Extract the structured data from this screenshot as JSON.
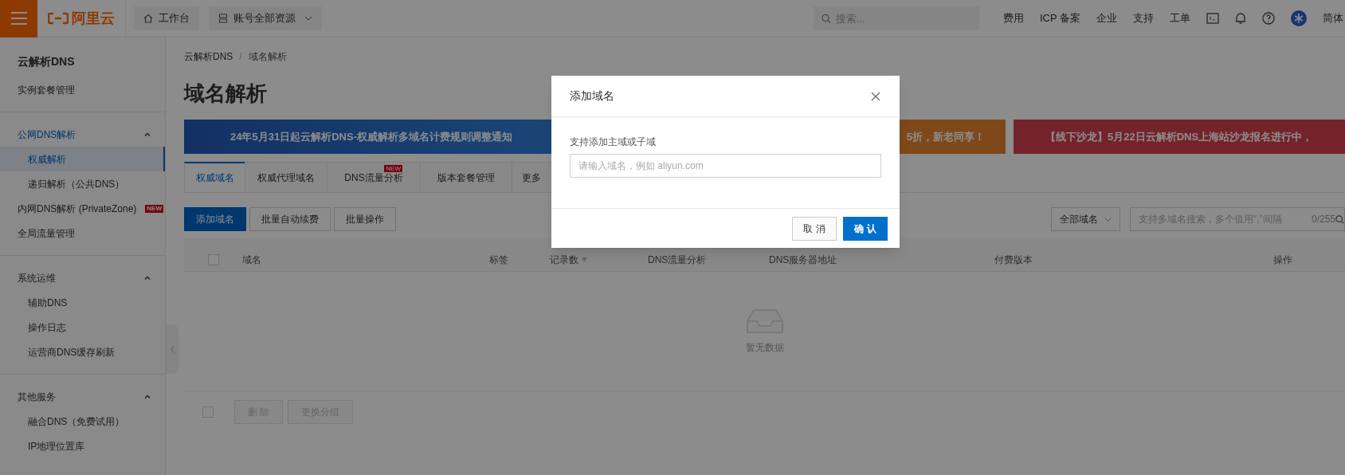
{
  "top_bar": {
    "brand": "阿里云",
    "workbench": "工作台",
    "resources": "账号全部资源",
    "search": {
      "placeholder": "搜索..."
    },
    "links": [
      "费用",
      "ICP 备案",
      "企业",
      "支持",
      "工单"
    ],
    "language": "简体"
  },
  "sidebar": {
    "title": "云解析DNS",
    "sections": [
      {
        "entries": [
          {
            "label": "实例套餐管理",
            "selected": false
          }
        ]
      },
      {
        "entries": [
          {
            "label": "公网DNS解析",
            "expanded": true,
            "selected": false,
            "children": [
              {
                "label": "权威解析",
                "selected": true
              },
              {
                "label": "递归解析（公共DNS）",
                "selected": false
              }
            ]
          },
          {
            "label": "内网DNS解析 (PrivateZone)",
            "badge": "NEW",
            "selected": false
          },
          {
            "label": "全局流量管理",
            "selected": false
          }
        ]
      },
      {
        "entries": [
          {
            "label": "系统运维",
            "expanded": true,
            "selected": false,
            "children": [
              {
                "label": "辅助DNS",
                "selected": false
              },
              {
                "label": "操作日志",
                "selected": false
              },
              {
                "label": "运营商DNS缓存刷新",
                "selected": false
              }
            ]
          }
        ]
      },
      {
        "entries": [
          {
            "label": "其他服务",
            "expanded": true,
            "selected": false,
            "children": [
              {
                "label": "融合DNS（免费试用）",
                "selected": false
              },
              {
                "label": "IP地理位置库",
                "selected": false
              }
            ]
          }
        ]
      }
    ]
  },
  "breadcrumb": [
    "云解析DNS",
    "域名解析"
  ],
  "breadcrumb_separator": "/",
  "page_title": "域名解析",
  "banners": [
    {
      "text": "24年5月31日起云解析DNS-权威解析多域名计费规则调整通知",
      "kind": "notice"
    },
    {
      "text": "5折，新老同享！",
      "kind": "promo"
    },
    {
      "text": "【线下沙龙】5月22日云解析DNS上海站沙龙报名进行中，",
      "kind": "event"
    }
  ],
  "tabs": [
    {
      "label": "权威域名",
      "selected": true
    },
    {
      "label": "权威代理域名",
      "selected": false
    },
    {
      "label": "DNS流量分析",
      "badge": "NEW",
      "selected": false
    },
    {
      "label": "版本套餐管理",
      "selected": false
    },
    {
      "label": "更多",
      "selected": false
    }
  ],
  "actions": [
    {
      "label": "添加域名",
      "kind": "primary"
    },
    {
      "label": "批量自动续费",
      "kind": "normal"
    },
    {
      "label": "批量操作",
      "kind": "normal"
    }
  ],
  "filter": {
    "select": "全部域名",
    "search": {
      "placeholder": "支持多域名搜索，多个值用\",\"间隔",
      "counter": "0/255"
    }
  },
  "table": {
    "header_checkbox": {
      "checked": false
    },
    "footer_checkbox": {
      "checked": false
    },
    "columns": [
      {
        "label": "域名"
      },
      {
        "label": "标签"
      },
      {
        "label": "记录数",
        "sortable": true
      },
      {
        "label": "DNS流量分析"
      },
      {
        "label": "DNS服务器地址"
      },
      {
        "label": "付费版本"
      },
      {
        "label": "操作"
      }
    ],
    "empty": "暂无数据",
    "footer_buttons": [
      {
        "label": "删 除",
        "disabled": true
      },
      {
        "label": "更换分组",
        "disabled": true
      }
    ]
  },
  "dialog": {
    "title": "添加域名",
    "field_label": "支持添加主域或子域",
    "input": {
      "placeholder": "请输入域名，例如 aliyun.com"
    },
    "buttons": [
      {
        "label": "取 消",
        "kind": "normal"
      },
      {
        "label": "确 认",
        "kind": "primary"
      }
    ]
  }
}
